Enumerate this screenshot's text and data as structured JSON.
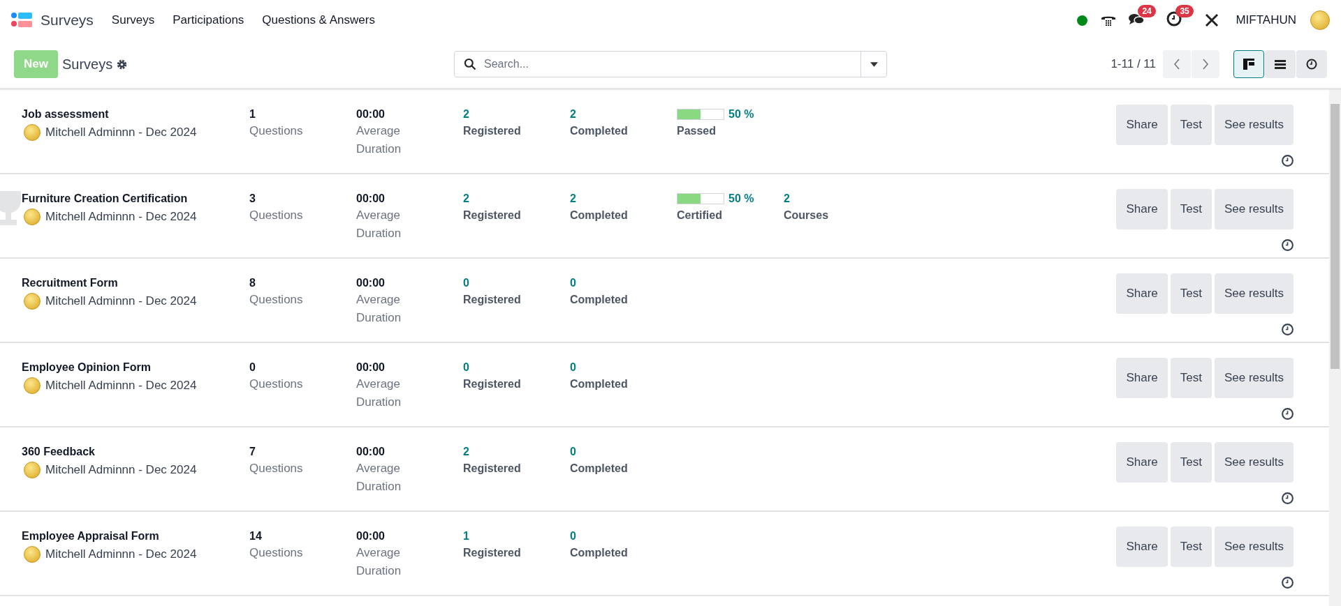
{
  "navbar": {
    "app_name": "Surveys",
    "menu": [
      "Surveys",
      "Participations",
      "Questions & Answers"
    ],
    "online": true,
    "messages_badge": "24",
    "activities_badge": "35",
    "user": "MIFTAHUN"
  },
  "control_panel": {
    "new_button": "New",
    "title": "Surveys",
    "search": {
      "placeholder": "Search..."
    },
    "pager": "1-11 / 11",
    "views": [
      {
        "kind": "kanban",
        "selected": true
      },
      {
        "kind": "list",
        "selected": false
      },
      {
        "kind": "activity",
        "selected": false
      }
    ]
  },
  "surveys": [
    {
      "name": "Job assessment",
      "author": "Mitchell Adminnn - Dec 2024",
      "certification": false,
      "questions": "1",
      "questions_label": "Questions",
      "duration": "00:00",
      "duration_label": "Average Duration",
      "registered": "2",
      "registered_label": "Registered",
      "completed": "2",
      "completed_label": "Completed",
      "success": {
        "level": 0.5,
        "percent": "50 %",
        "label": "Passed"
      },
      "buttons": [
        "Share",
        "Test",
        "See results"
      ]
    },
    {
      "name": "Furniture Creation Certification",
      "author": "Mitchell Adminnn - Dec 2024",
      "certification": true,
      "questions": "3",
      "questions_label": "Questions",
      "duration": "00:00",
      "duration_label": "Average Duration",
      "registered": "2",
      "registered_label": "Registered",
      "completed": "2",
      "completed_label": "Completed",
      "success": {
        "level": 0.5,
        "percent": "50 %",
        "label": "Certified"
      },
      "courses": {
        "value": "2",
        "label": "Courses"
      },
      "buttons": [
        "Share",
        "Test",
        "See results"
      ]
    },
    {
      "name": "Recruitment Form",
      "author": "Mitchell Adminnn - Dec 2024",
      "certification": false,
      "questions": "8",
      "questions_label": "Questions",
      "duration": "00:00",
      "duration_label": "Average Duration",
      "registered": "0",
      "registered_label": "Registered",
      "completed": "0",
      "completed_label": "Completed",
      "buttons": [
        "Share",
        "Test",
        "See results"
      ]
    },
    {
      "name": "Employee Opinion Form",
      "author": "Mitchell Adminnn - Dec 2024",
      "certification": false,
      "questions": "0",
      "questions_label": "Questions",
      "duration": "00:00",
      "duration_label": "Average Duration",
      "registered": "0",
      "registered_label": "Registered",
      "completed": "0",
      "completed_label": "Completed",
      "buttons": [
        "Share",
        "Test",
        "See results"
      ]
    },
    {
      "name": "360 Feedback",
      "author": "Mitchell Adminnn - Dec 2024",
      "certification": false,
      "questions": "7",
      "questions_label": "Questions",
      "duration": "00:00",
      "duration_label": "Average Duration",
      "registered": "2",
      "registered_label": "Registered",
      "completed": "0",
      "completed_label": "Completed",
      "buttons": [
        "Share",
        "Test",
        "See results"
      ]
    },
    {
      "name": "Employee Appraisal Form",
      "author": "Mitchell Adminnn - Dec 2024",
      "certification": false,
      "questions": "14",
      "questions_label": "Questions",
      "duration": "00:00",
      "duration_label": "Average Duration",
      "registered": "1",
      "registered_label": "Registered",
      "completed": "0",
      "completed_label": "Completed",
      "buttons": [
        "Share",
        "Test",
        "See results"
      ]
    }
  ]
}
